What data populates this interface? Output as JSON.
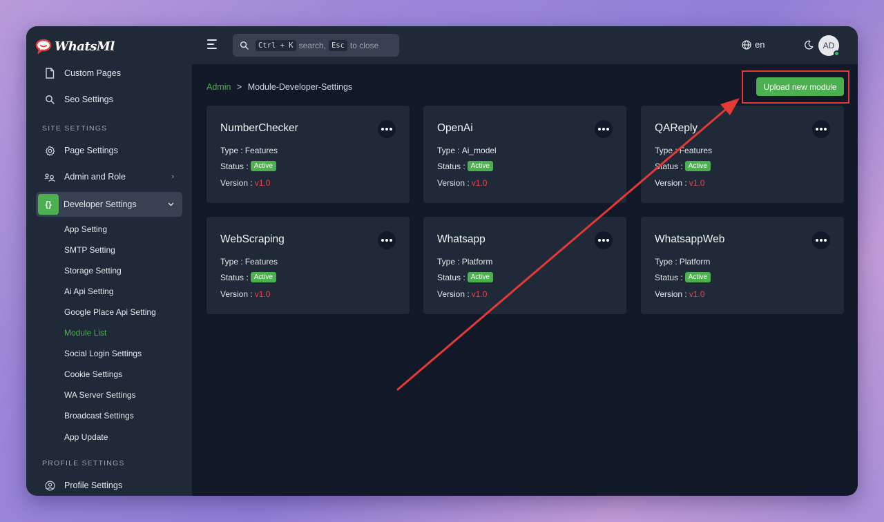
{
  "app": {
    "logo_text": "WhatsMl"
  },
  "sidebar": {
    "top_items": [
      {
        "label": "Custom Pages",
        "icon": "file-icon"
      },
      {
        "label": "Seo Settings",
        "icon": "search-icon"
      }
    ],
    "site_settings_heading": "SITE SETTINGS",
    "site_items": [
      {
        "label": "Page Settings",
        "icon": "gear-icon"
      },
      {
        "label": "Admin and Role",
        "icon": "users-icon"
      },
      {
        "label": "Developer Settings",
        "icon": "braces-icon",
        "icon_text": "{}"
      }
    ],
    "developer_sub_items": [
      "App Setting",
      "SMTP Setting",
      "Storage Setting",
      "Ai Api Setting",
      "Google Place Api Setting",
      "Module List",
      "Social Login Settings",
      "Cookie Settings",
      "WA Server Settings",
      "Broadcast Settings",
      "App Update"
    ],
    "profile_settings_heading": "PROFILE SETTINGS",
    "profile_items": [
      {
        "label": "Profile Settings",
        "icon": "user-circle-icon"
      }
    ]
  },
  "header": {
    "search": {
      "kbd1": "Ctrl + K",
      "text1": "search,",
      "kbd2": "Esc",
      "text2": "to close"
    },
    "language": "en",
    "avatar_initials": "AD"
  },
  "breadcrumb": {
    "root": "Admin",
    "separator": ">",
    "current": "Module-Developer-Settings"
  },
  "upload_button": "Upload new module",
  "labels": {
    "type": "Type :",
    "status": "Status :",
    "version": "Version :"
  },
  "modules": [
    {
      "name": "NumberChecker",
      "type": "Features",
      "status": "Active",
      "version": "v1.0"
    },
    {
      "name": "OpenAi",
      "type": "Ai_model",
      "status": "Active",
      "version": "v1.0"
    },
    {
      "name": "QAReply",
      "type": "Features",
      "status": "Active",
      "version": "v1.0"
    },
    {
      "name": "WebScraping",
      "type": "Features",
      "status": "Active",
      "version": "v1.0"
    },
    {
      "name": "Whatsapp",
      "type": "Platform",
      "status": "Active",
      "version": "v1.0"
    },
    {
      "name": "WhatsappWeb",
      "type": "Platform",
      "status": "Active",
      "version": "v1.0"
    }
  ],
  "colors": {
    "accent": "#4caf50",
    "version": "#ef4444",
    "annotation": "#e53935"
  }
}
